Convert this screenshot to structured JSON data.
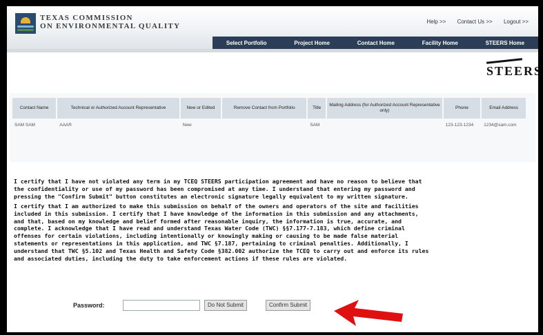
{
  "header": {
    "org_line1": "Texas Commission",
    "org_line2": "on Environmental Quality",
    "top_links": [
      "Help >>",
      "Contact Us >>",
      "Logout >>"
    ],
    "nav": [
      "Select Portfolio",
      "Project Home",
      "Contact Home",
      "Facility Home",
      "STEERS Home"
    ]
  },
  "brand": {
    "steers_logo": "STEERS"
  },
  "table": {
    "columns": [
      "Contact Name",
      "Technical or Authorized Account Representative",
      "New or Edited",
      "Remove Contact from Portfolio",
      "Title",
      "Mailing Address (for Authorized Account Representative only)",
      "Phone",
      "Email Address"
    ],
    "rows": [
      [
        "SAM SAM",
        "AAAR",
        "New",
        "",
        "SAM",
        "",
        "123-123-1234",
        "1234@sam.com"
      ]
    ]
  },
  "certification": {
    "paragraph1": "I certify that I have not violated any term in my TCEQ STEERS participation agreement and have no reason to believe that the confidentiality or use of my password has been compromised at any time. I understand that entering my password and pressing the \"Confirm Submit\" button constitutes an electronic signature legally equivalent to my written signature.",
    "paragraph2": "I certify that I am authorized to make this submission on behalf of the owners and operators of the site and facilities included in this submission. I certify that I have knowledge of the information in this submission and any attachments, and that, based on my knowledge and belief formed after reasonable inquiry, the information is true, accurate, and complete. I acknowledge that I have read and understand Texas Water Code (TWC) §§7.177-7.183, which define criminal offenses for certain violations, including intentionally or knowingly making or causing to be made false material statements or representations in this application, and TWC §7.187, pertaining to criminal penalties. Additionally, I understand that TWC §5.102 and Texas Health and Safety Code §382.002 authorize the TCEQ to carry out and enforce its rules and associated duties, including the duty to take enforcement actions if these rules are violated."
  },
  "form": {
    "password_label": "Password:",
    "password_value": "",
    "do_not_submit": "Do Not Submit",
    "confirm_submit": "Confirm Submit"
  },
  "colors": {
    "nav_bg": "#2c3e57",
    "arrow": "#e01010",
    "table_header": "#d7dde4"
  }
}
